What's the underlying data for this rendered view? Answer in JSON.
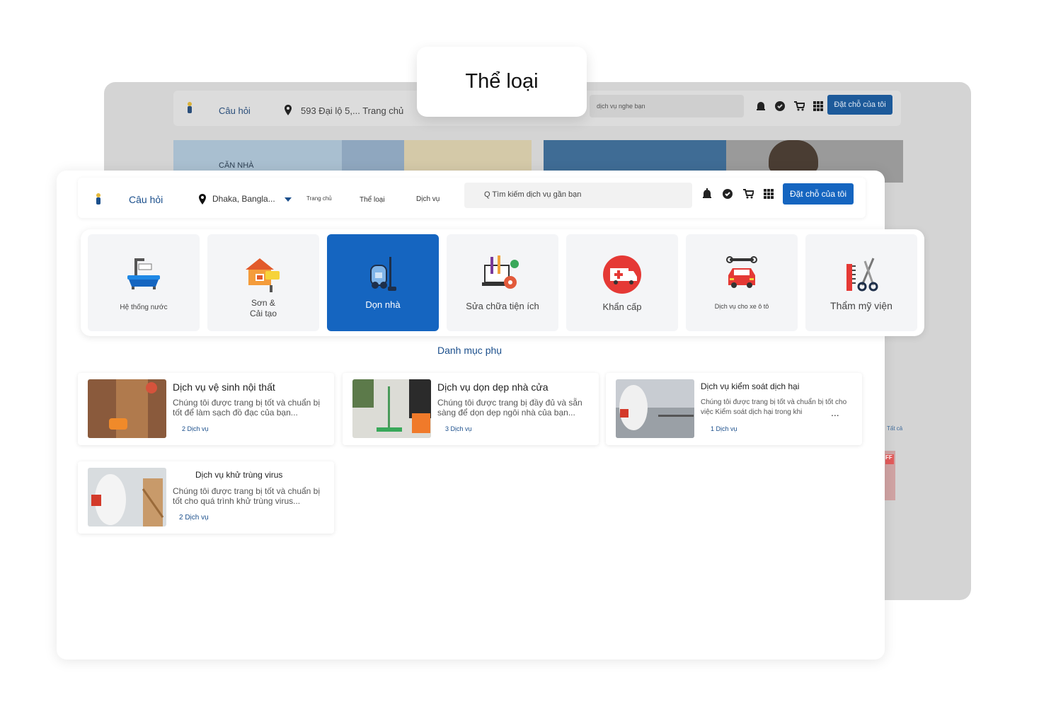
{
  "background_window": {
    "help": "Câu hỏi",
    "address": "593 Đại lộ 5,... Trang chủ",
    "search_text": "dịch vụ nghe bạn",
    "cta": "Đặt chỗ của tôi",
    "banner_text": "CĂN NHÀ",
    "side_link": "Tất cả",
    "side_badge": "FF"
  },
  "title_pill": {
    "text": "Thể loại"
  },
  "navbar": {
    "help": "Câu hỏi",
    "location": "Dhaka, Bangla...",
    "menu": [
      "Trang chủ",
      "Thể loại",
      "Dịch vụ"
    ],
    "search_placeholder": "Q Tìm kiếm dịch vụ gần bạn",
    "cta": "Đặt chỗ của tôi",
    "icons": [
      "alarm-icon",
      "settings-badge-icon",
      "cart-icon",
      "grid-icon"
    ]
  },
  "categories": [
    {
      "label": "Hệ thống nước",
      "icon": "bathtub-icon",
      "active": false
    },
    {
      "label": "Sơn &\nCải tạo",
      "icon": "house-paint-icon",
      "active": false
    },
    {
      "label": "Dọn nhà",
      "icon": "vacuum-icon",
      "active": true
    },
    {
      "label": "Sửa chữa tiện ích",
      "icon": "tools-laptop-icon",
      "active": false
    },
    {
      "label": "Khẩn cấp",
      "icon": "ambulance-icon",
      "active": false
    },
    {
      "label": "Dịch vụ cho xe ô tô",
      "icon": "car-wrench-icon",
      "active": false
    },
    {
      "label": "Thẩm mỹ viện",
      "icon": "comb-scissors-icon",
      "active": false
    }
  ],
  "subcategory_heading": "Danh mục phụ",
  "services": [
    {
      "title": "Dịch vụ vệ sinh nội thất",
      "description": "Chúng tôi được trang bị tốt và chuẩn bị tốt để làm sạch đồ đạc của bạn...",
      "count": "2 Dịch vụ"
    },
    {
      "title": "Dịch vụ dọn dẹp nhà cửa",
      "description": "Chúng tôi được trang bị đầy đủ và sẵn sàng để dọn dẹp ngôi nhà của bạn...",
      "count": "3 Dịch vụ"
    },
    {
      "title": "Dịch vụ kiểm soát dịch hại",
      "description": "Chúng tôi được trang bị tốt và chuẩn bị tốt cho việc Kiểm soát dịch hại trong khi",
      "count": "1 Dịch vụ",
      "more": "..."
    },
    {
      "title": "Dịch vụ khử trùng virus",
      "description": "Chúng tôi được trang bị tốt và chuẩn bị tốt cho quá trình khử trùng virus...",
      "count": "2 Dịch vụ"
    }
  ],
  "colors": {
    "primary": "#1565c0",
    "link": "#1b4f8c",
    "tile_bg": "#f4f5f7"
  }
}
